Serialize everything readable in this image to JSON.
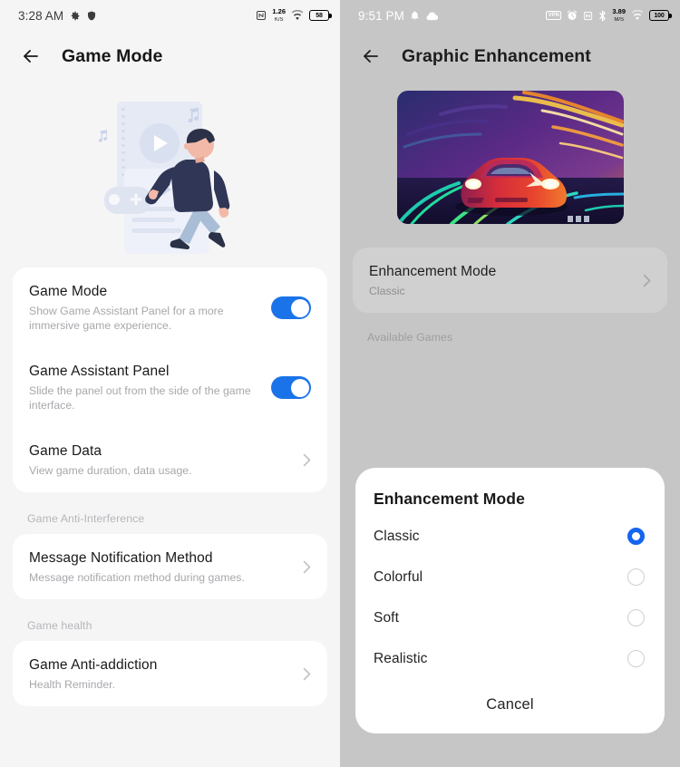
{
  "left_phone": {
    "status_bar": {
      "time": "3:28 AM",
      "left_icons": [
        "gear-icon",
        "shield-icon"
      ],
      "right_icons": [
        "nfc-icon",
        "wifi-icon"
      ],
      "net_speed_value": "1.26",
      "net_speed_unit": "K/S",
      "battery_level": "58"
    },
    "app_bar": {
      "back": "back-arrow-icon",
      "title": "Game Mode"
    },
    "illustration": "person-reaching-play-button-illustration",
    "cards": [
      {
        "rows": [
          {
            "title": "Game Mode",
            "subtitle": "Show Game Assistant Panel for a more immersive game experience.",
            "control": "toggle",
            "toggle_on": true
          },
          {
            "title": "Game Assistant Panel",
            "subtitle": "Slide the panel out from the side of the game interface.",
            "control": "toggle",
            "toggle_on": true
          },
          {
            "title": "Game Data",
            "subtitle": "View game duration, data usage.",
            "control": "chevron"
          }
        ]
      }
    ],
    "section_anti_interference": "Game Anti-Interference",
    "card_anti_interference": {
      "title": "Message Notification Method",
      "subtitle": "Message notification method during games.",
      "control": "chevron"
    },
    "section_health": "Game health",
    "card_health": {
      "title": "Game Anti-addiction",
      "subtitle": "Health Reminder.",
      "control": "chevron"
    }
  },
  "right_phone": {
    "status_bar": {
      "time": "9:51 PM",
      "left_icons": [
        "bell-icon",
        "cloud-icon"
      ],
      "right_icons": [
        "vpn-icon",
        "alarm-icon",
        "nfc-icon",
        "bluetooth-icon",
        "wifi-icon"
      ],
      "vpn_label": "VPN",
      "net_speed_value": "3.89",
      "net_speed_unit": "M/S",
      "battery_level": "100"
    },
    "app_bar": {
      "back": "back-arrow-icon",
      "title": "Graphic Enhancement"
    },
    "banner": "neon-racing-car-game-banner",
    "enhancement_row": {
      "title": "Enhancement Mode",
      "subtitle": "Classic",
      "control": "chevron"
    },
    "section_available_games": "Available Games",
    "dialog": {
      "title": "Enhancement Mode",
      "options": [
        {
          "label": "Classic",
          "selected": true
        },
        {
          "label": "Colorful",
          "selected": false
        },
        {
          "label": "Soft",
          "selected": false
        },
        {
          "label": "Realistic",
          "selected": false
        }
      ],
      "cancel_label": "Cancel"
    }
  },
  "colors": {
    "accent_blue": "#1a73e8",
    "radio_blue": "#1565f0",
    "left_bg": "#f5f5f6",
    "right_dim_bg": "#c6c6c6",
    "card_white": "#ffffff"
  }
}
